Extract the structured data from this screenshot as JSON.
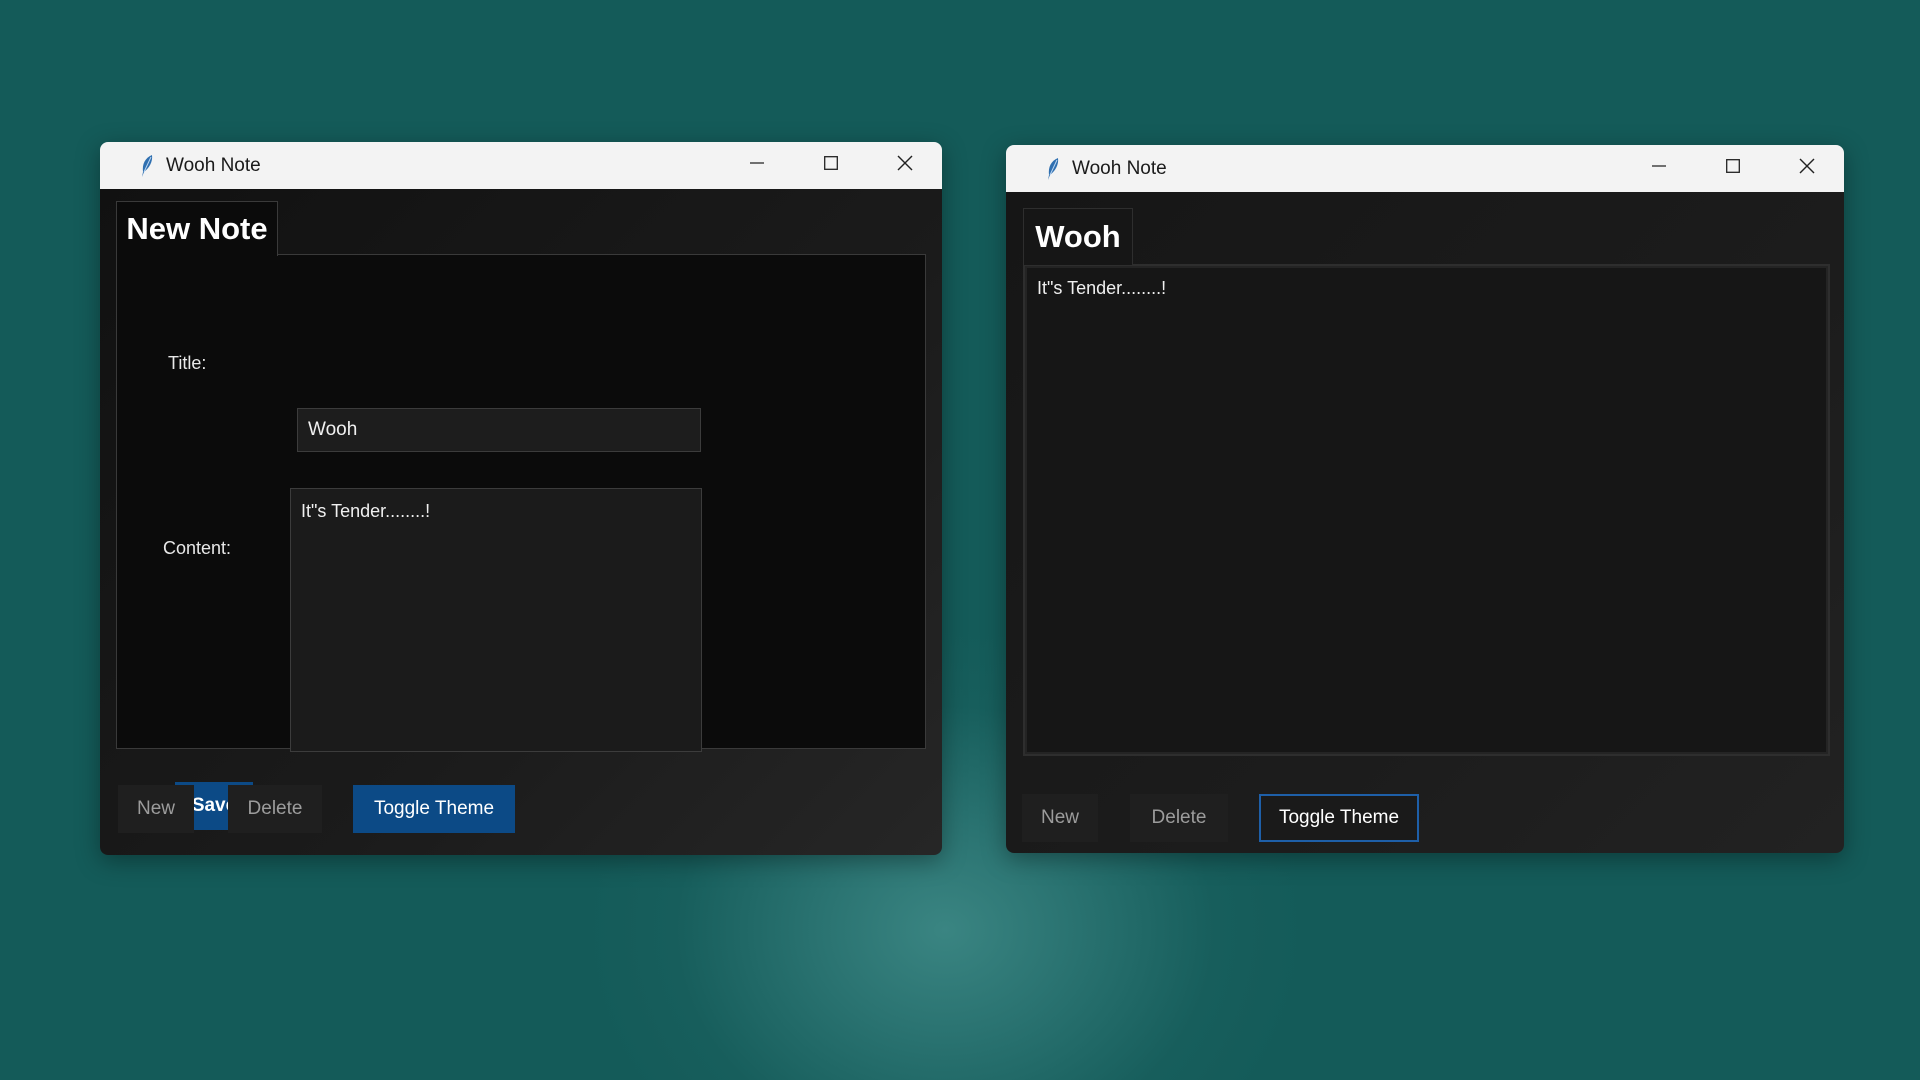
{
  "windows": [
    {
      "title": "Wooh Note",
      "tab_label": "New Note",
      "form": {
        "title_label": "Title:",
        "title_value": "Wooh",
        "content_label": "Content:",
        "content_value": "It\"s Tender........!",
        "save_label": "Save"
      },
      "buttons": {
        "new_label": "New",
        "delete_label": "Delete",
        "toggle_label": "Toggle Theme"
      }
    },
    {
      "title": "Wooh Note",
      "tab_label": "Wooh",
      "note_text": "It\"s Tender........!",
      "buttons": {
        "new_label": "New",
        "delete_label": "Delete",
        "toggle_label": "Toggle Theme"
      }
    }
  ],
  "colors": {
    "desktop": "#155d5b",
    "accent_blue": "#0c4a86",
    "outline_blue": "#1e5fa8",
    "window_bg": "#111111",
    "titlebar_bg": "#f3f3f3"
  },
  "icons": {
    "app": "feather-icon",
    "minimize": "minimize-icon",
    "maximize": "maximize-icon",
    "close": "close-icon"
  }
}
